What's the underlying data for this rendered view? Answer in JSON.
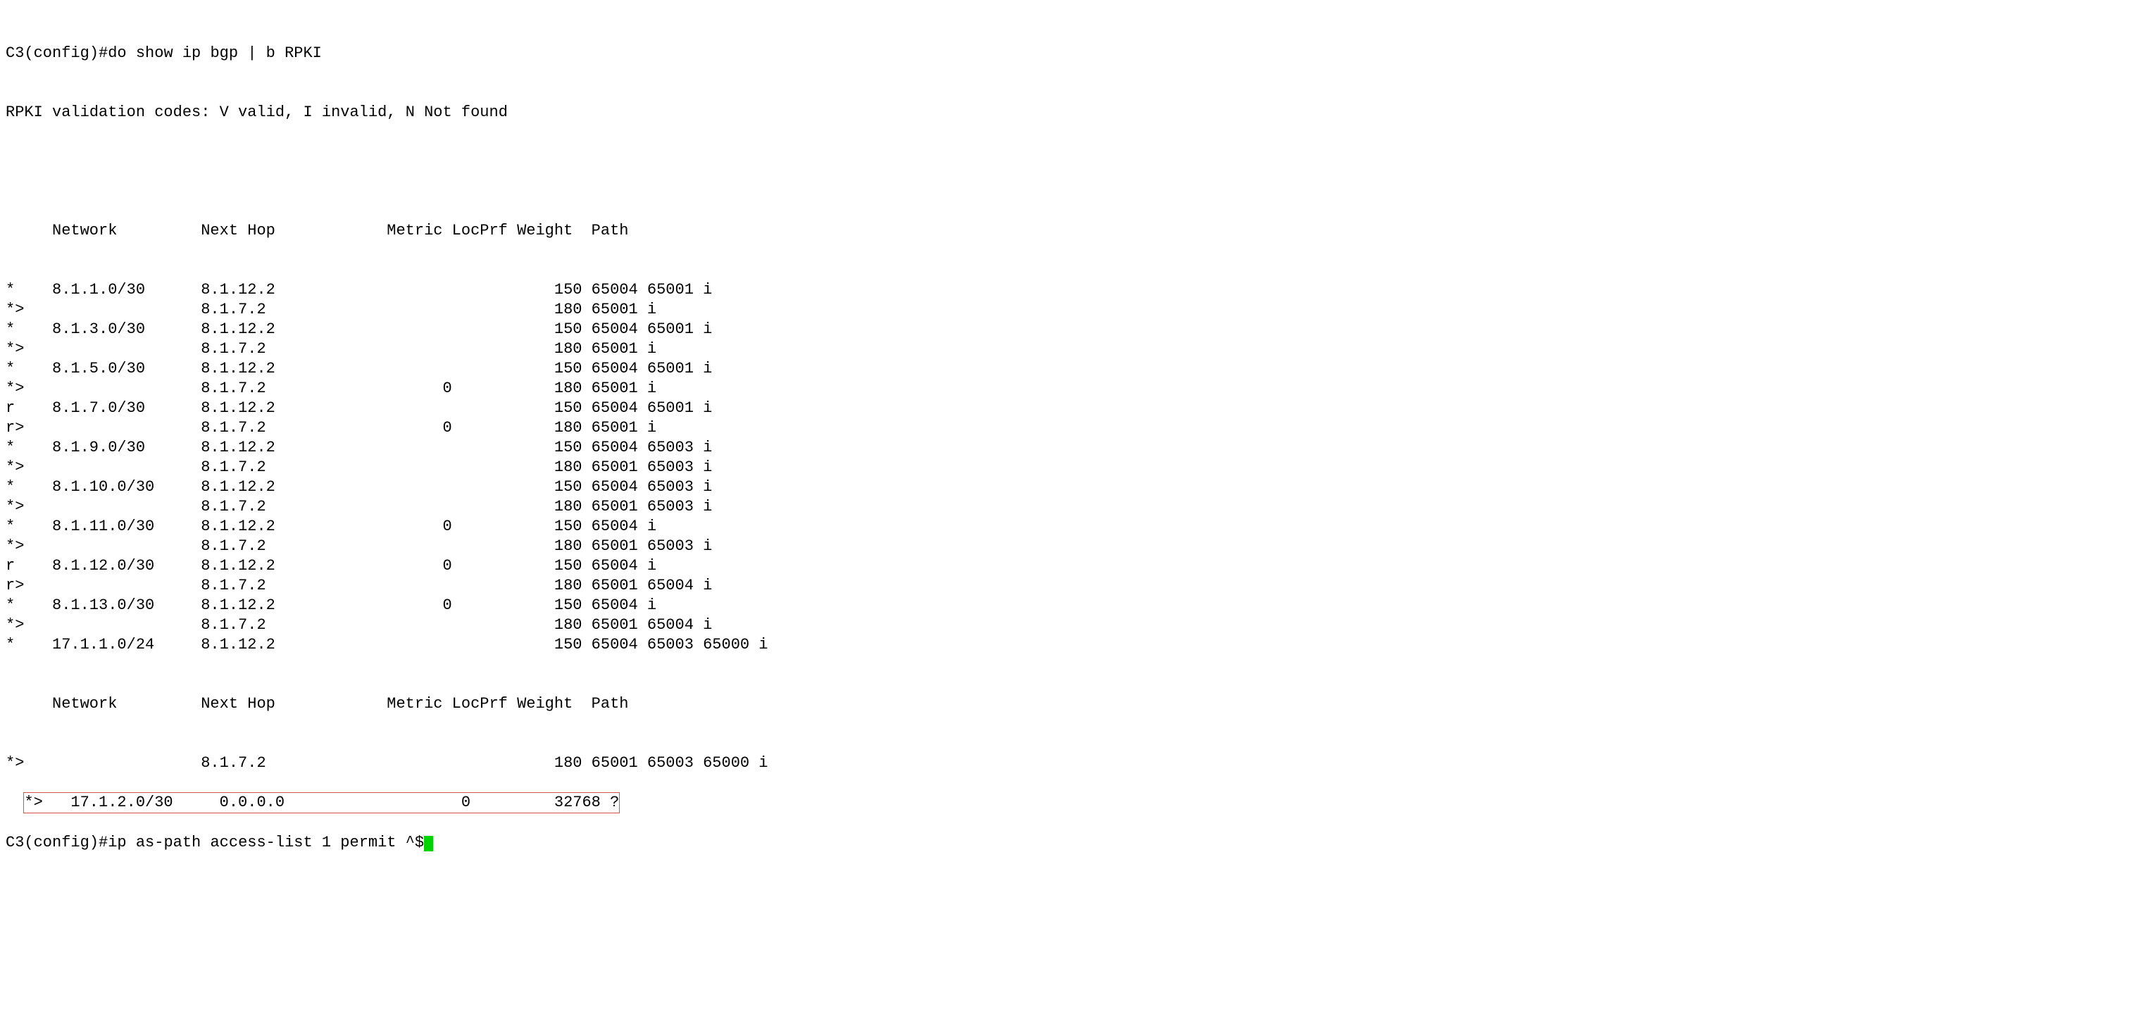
{
  "prompt1": "C3(config)#",
  "command1": "do show ip bgp | b RPKI",
  "codes_line": "RPKI validation codes: V valid, I invalid, N Not found",
  "headers": {
    "status": "",
    "network": "Network",
    "nexthop": "Next Hop",
    "metric": "Metric",
    "locprf": "LocPrf",
    "weight": "Weight",
    "path": "Path"
  },
  "rows": [
    {
      "status": "*",
      "network": "8.1.1.0/30",
      "nexthop": "8.1.12.2",
      "metric": "",
      "locprf": "",
      "weight": "150",
      "path": "65004 65001 i"
    },
    {
      "status": "*>",
      "network": "",
      "nexthop": "8.1.7.2",
      "metric": "",
      "locprf": "",
      "weight": "180",
      "path": "65001 i"
    },
    {
      "status": "*",
      "network": "8.1.3.0/30",
      "nexthop": "8.1.12.2",
      "metric": "",
      "locprf": "",
      "weight": "150",
      "path": "65004 65001 i"
    },
    {
      "status": "*>",
      "network": "",
      "nexthop": "8.1.7.2",
      "metric": "",
      "locprf": "",
      "weight": "180",
      "path": "65001 i"
    },
    {
      "status": "*",
      "network": "8.1.5.0/30",
      "nexthop": "8.1.12.2",
      "metric": "",
      "locprf": "",
      "weight": "150",
      "path": "65004 65001 i"
    },
    {
      "status": "*>",
      "network": "",
      "nexthop": "8.1.7.2",
      "metric": "0",
      "locprf": "",
      "weight": "180",
      "path": "65001 i"
    },
    {
      "status": "r",
      "network": "8.1.7.0/30",
      "nexthop": "8.1.12.2",
      "metric": "",
      "locprf": "",
      "weight": "150",
      "path": "65004 65001 i"
    },
    {
      "status": "r>",
      "network": "",
      "nexthop": "8.1.7.2",
      "metric": "0",
      "locprf": "",
      "weight": "180",
      "path": "65001 i"
    },
    {
      "status": "*",
      "network": "8.1.9.0/30",
      "nexthop": "8.1.12.2",
      "metric": "",
      "locprf": "",
      "weight": "150",
      "path": "65004 65003 i"
    },
    {
      "status": "*>",
      "network": "",
      "nexthop": "8.1.7.2",
      "metric": "",
      "locprf": "",
      "weight": "180",
      "path": "65001 65003 i"
    },
    {
      "status": "*",
      "network": "8.1.10.0/30",
      "nexthop": "8.1.12.2",
      "metric": "",
      "locprf": "",
      "weight": "150",
      "path": "65004 65003 i"
    },
    {
      "status": "*>",
      "network": "",
      "nexthop": "8.1.7.2",
      "metric": "",
      "locprf": "",
      "weight": "180",
      "path": "65001 65003 i"
    },
    {
      "status": "*",
      "network": "8.1.11.0/30",
      "nexthop": "8.1.12.2",
      "metric": "0",
      "locprf": "",
      "weight": "150",
      "path": "65004 i"
    },
    {
      "status": "*>",
      "network": "",
      "nexthop": "8.1.7.2",
      "metric": "",
      "locprf": "",
      "weight": "180",
      "path": "65001 65003 i"
    },
    {
      "status": "r",
      "network": "8.1.12.0/30",
      "nexthop": "8.1.12.2",
      "metric": "0",
      "locprf": "",
      "weight": "150",
      "path": "65004 i"
    },
    {
      "status": "r>",
      "network": "",
      "nexthop": "8.1.7.2",
      "metric": "",
      "locprf": "",
      "weight": "180",
      "path": "65001 65004 i"
    },
    {
      "status": "*",
      "network": "8.1.13.0/30",
      "nexthop": "8.1.12.2",
      "metric": "0",
      "locprf": "",
      "weight": "150",
      "path": "65004 i"
    },
    {
      "status": "*>",
      "network": "",
      "nexthop": "8.1.7.2",
      "metric": "",
      "locprf": "",
      "weight": "180",
      "path": "65001 65004 i"
    },
    {
      "status": "*",
      "network": "17.1.1.0/24",
      "nexthop": "8.1.12.2",
      "metric": "",
      "locprf": "",
      "weight": "150",
      "path": "65004 65003 65000 i"
    }
  ],
  "rows2": [
    {
      "status": "*>",
      "network": "",
      "nexthop": "8.1.7.2",
      "metric": "",
      "locprf": "",
      "weight": "180",
      "path": "65001 65003 65000 i"
    }
  ],
  "highlight_row": {
    "status": "*>",
    "network": "17.1.2.0/30",
    "nexthop": "0.0.0.0",
    "metric": "0",
    "locprf": "",
    "weight": "32768",
    "path": "?"
  },
  "prompt2": "C3(config)#",
  "command2": "ip as-path access-list 1 permit ^$"
}
